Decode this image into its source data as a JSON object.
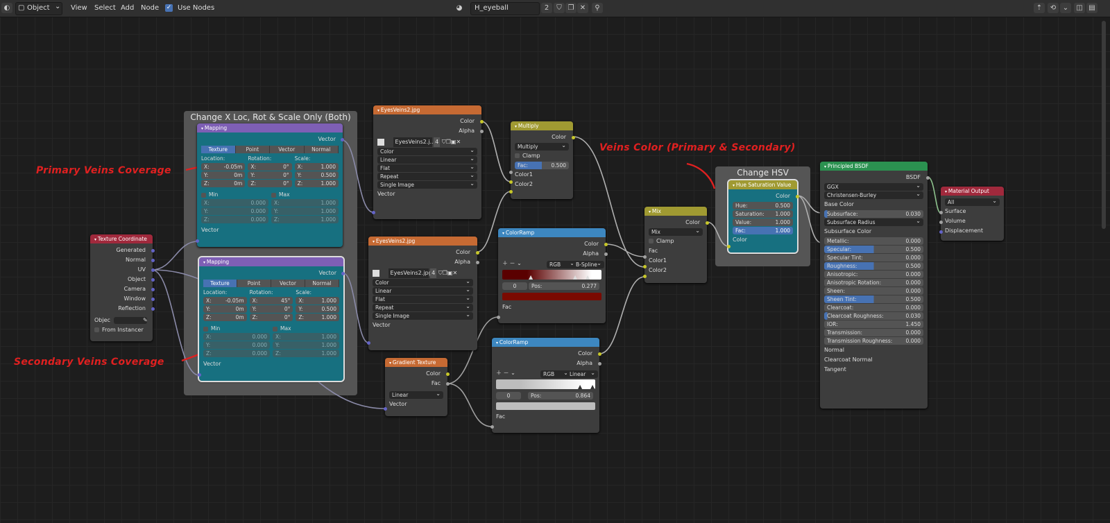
{
  "topbar": {
    "editor_icon": "node-editor-icon",
    "mode": "Object",
    "menus": [
      "View",
      "Select",
      "Add",
      "Node"
    ],
    "use_nodes": "Use Nodes",
    "material": "H_eyeball",
    "users": "2"
  },
  "frames": {
    "mapping": "Change X Loc, Rot & Scale Only (Both)",
    "hsv": "Change HSV"
  },
  "annotations": {
    "primary": "Primary Veins Coverage",
    "secondary": "Secondary Veins Coverage",
    "veins_color": "Veins Color (Primary & Secondary)"
  },
  "texcoord": {
    "title": "Texture Coordinate",
    "outputs": [
      "Generated",
      "Normal",
      "UV",
      "Object",
      "Camera",
      "Window",
      "Reflection"
    ],
    "object_label": "Objec",
    "from_instancer": "From Instancer"
  },
  "mapping1": {
    "title": "Mapping",
    "out": "Vector",
    "tabs": [
      "Texture",
      "Point",
      "Vector",
      "Normal"
    ],
    "loc": "Location:",
    "rot": "Rotation:",
    "scale": "Scale:",
    "loc_vals": [
      "-0.05m",
      "0m",
      "0m"
    ],
    "rot_vals": [
      "0°",
      "0°",
      "0°"
    ],
    "scale_vals": [
      "1.000",
      "0.500",
      "1.000"
    ],
    "min": "Min",
    "max": "Max",
    "min_vals": [
      "0.000",
      "0.000",
      "0.000"
    ],
    "max_vals": [
      "1.000",
      "1.000",
      "1.000"
    ],
    "in": "Vector"
  },
  "mapping2": {
    "title": "Mapping",
    "out": "Vector",
    "tabs": [
      "Texture",
      "Point",
      "Vector",
      "Normal"
    ],
    "loc": "Location:",
    "rot": "Rotation:",
    "scale": "Scale:",
    "loc_vals": [
      "-0.05m",
      "0m",
      "0m"
    ],
    "rot_vals": [
      "45°",
      "0°",
      "0°"
    ],
    "scale_vals": [
      "1.000",
      "0.500",
      "1.000"
    ],
    "min": "Min",
    "max": "Max",
    "min_vals": [
      "0.000",
      "0.000",
      "0.000"
    ],
    "max_vals": [
      "1.000",
      "1.000",
      "1.000"
    ],
    "in": "Vector"
  },
  "axes": [
    "X:",
    "Y:",
    "Z:"
  ],
  "img1": {
    "title": "EyesVeins2.jpg",
    "outputs": [
      "Color",
      "Alpha"
    ],
    "file": "EyesVeins2.j...",
    "users": "4",
    "opts": [
      "Color",
      "Linear",
      "Flat",
      "Repeat",
      "Single Image"
    ],
    "in": "Vector"
  },
  "img2": {
    "title": "EyesVeins2.jpg",
    "outputs": [
      "Color",
      "Alpha"
    ],
    "file": "EyesVeins2.jpg",
    "users": "4",
    "opts": [
      "Color",
      "Linear",
      "Flat",
      "Repeat",
      "Single Image"
    ],
    "in": "Vector"
  },
  "multiply": {
    "title": "Multiply",
    "out": "Color",
    "mode": "Multiply",
    "clamp": "Clamp",
    "fac_label": "Fac:",
    "fac": "0.500",
    "inputs": [
      "Color1",
      "Color2"
    ]
  },
  "ramp1": {
    "title": "ColorRamp",
    "outputs": [
      "Color",
      "Alpha"
    ],
    "mode": "RGB",
    "interp": "B-Spline",
    "index": "0",
    "pos_label": "Pos:",
    "pos": "0.277",
    "in": "Fac",
    "gradient": [
      "#5a0000",
      "#ffffff"
    ],
    "swatch": "#7a0a00"
  },
  "ramp2": {
    "title": "ColorRamp",
    "outputs": [
      "Color",
      "Alpha"
    ],
    "mode": "RGB",
    "interp": "Linear",
    "index": "0",
    "pos_label": "Pos:",
    "pos": "0.864",
    "in": "Fac",
    "gradient": [
      "#bdbdbd",
      "#ffffff"
    ],
    "swatch": "#bdbdbd"
  },
  "gradient": {
    "title": "Gradient Texture",
    "outputs": [
      "Color",
      "Fac"
    ],
    "type": "Linear",
    "in": "Vector"
  },
  "mix": {
    "title": "Mix",
    "out": "Color",
    "mode": "Mix",
    "clamp": "Clamp",
    "inputs": [
      "Fac",
      "Color1",
      "Color2"
    ]
  },
  "hsv": {
    "title": "Hue Saturation Value",
    "out": "Color",
    "fields": [
      {
        "l": "Hue:",
        "v": "0.500"
      },
      {
        "l": "Saturation:",
        "v": "1.000"
      },
      {
        "l": "Value:",
        "v": "1.000"
      },
      {
        "l": "Fac:",
        "v": "1.000"
      }
    ],
    "in": "Color"
  },
  "bsdf": {
    "title": "Principled BSDF",
    "out": "BSDF",
    "dist": "GGX",
    "sss": "Christensen-Burley",
    "base": "Base Color",
    "subsurface": {
      "l": "Subsurface:",
      "v": "0.030"
    },
    "ss_radius": "Subsurface Radius",
    "ss_color": "Subsurface Color",
    "fields": [
      {
        "l": "Metallic:",
        "v": "0.000"
      },
      {
        "l": "Specular:",
        "v": "0.500"
      },
      {
        "l": "Specular Tint:",
        "v": "0.000"
      },
      {
        "l": "Roughness:",
        "v": "0.500"
      },
      {
        "l": "Anisotropic:",
        "v": "0.000"
      },
      {
        "l": "Anisotropic Rotation:",
        "v": "0.000"
      },
      {
        "l": "Sheen:",
        "v": "0.000"
      },
      {
        "l": "Sheen Tint:",
        "v": "0.500"
      },
      {
        "l": "Clearcoat:",
        "v": "0.000"
      },
      {
        "l": "Clearcoat Roughness:",
        "v": "0.030"
      },
      {
        "l": "IOR:",
        "v": "1.450"
      },
      {
        "l": "Transmission:",
        "v": "0.000"
      },
      {
        "l": "Transmission Roughness:",
        "v": "0.000"
      }
    ],
    "vectors": [
      "Normal",
      "Clearcoat Normal",
      "Tangent"
    ]
  },
  "output": {
    "title": "Material Output",
    "target": "All",
    "inputs": [
      "Surface",
      "Volume",
      "Displacement"
    ]
  },
  "colors": {
    "header_input": "#a0293c",
    "header_vector": "#7e5fb5",
    "header_texture": "#c66a33",
    "header_color": "#a09a32",
    "header_converter": "#3d87c0",
    "header_shader": "#2b9150",
    "header_output": "#a0293c",
    "annotation": "#e02020",
    "selected": "#4772b3"
  }
}
